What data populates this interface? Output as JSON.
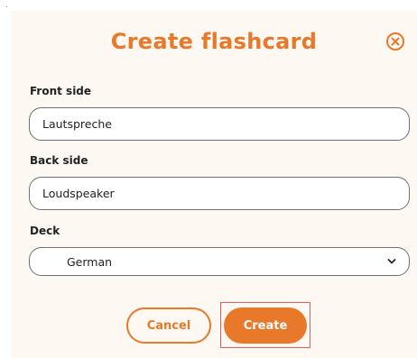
{
  "dialog": {
    "title": "Create flashcard",
    "close_icon": "close-circle-icon"
  },
  "form": {
    "front": {
      "label": "Front side",
      "value": "Lautspreche"
    },
    "back": {
      "label": "Back side",
      "value": "Loudspeaker"
    },
    "deck": {
      "label": "Deck",
      "selected": "German",
      "icon": "chevron-down-icon"
    }
  },
  "actions": {
    "cancel_label": "Cancel",
    "create_label": "Create"
  },
  "colors": {
    "accent": "#e8782a",
    "background": "#fdf8f1",
    "highlight": "#e06060"
  }
}
